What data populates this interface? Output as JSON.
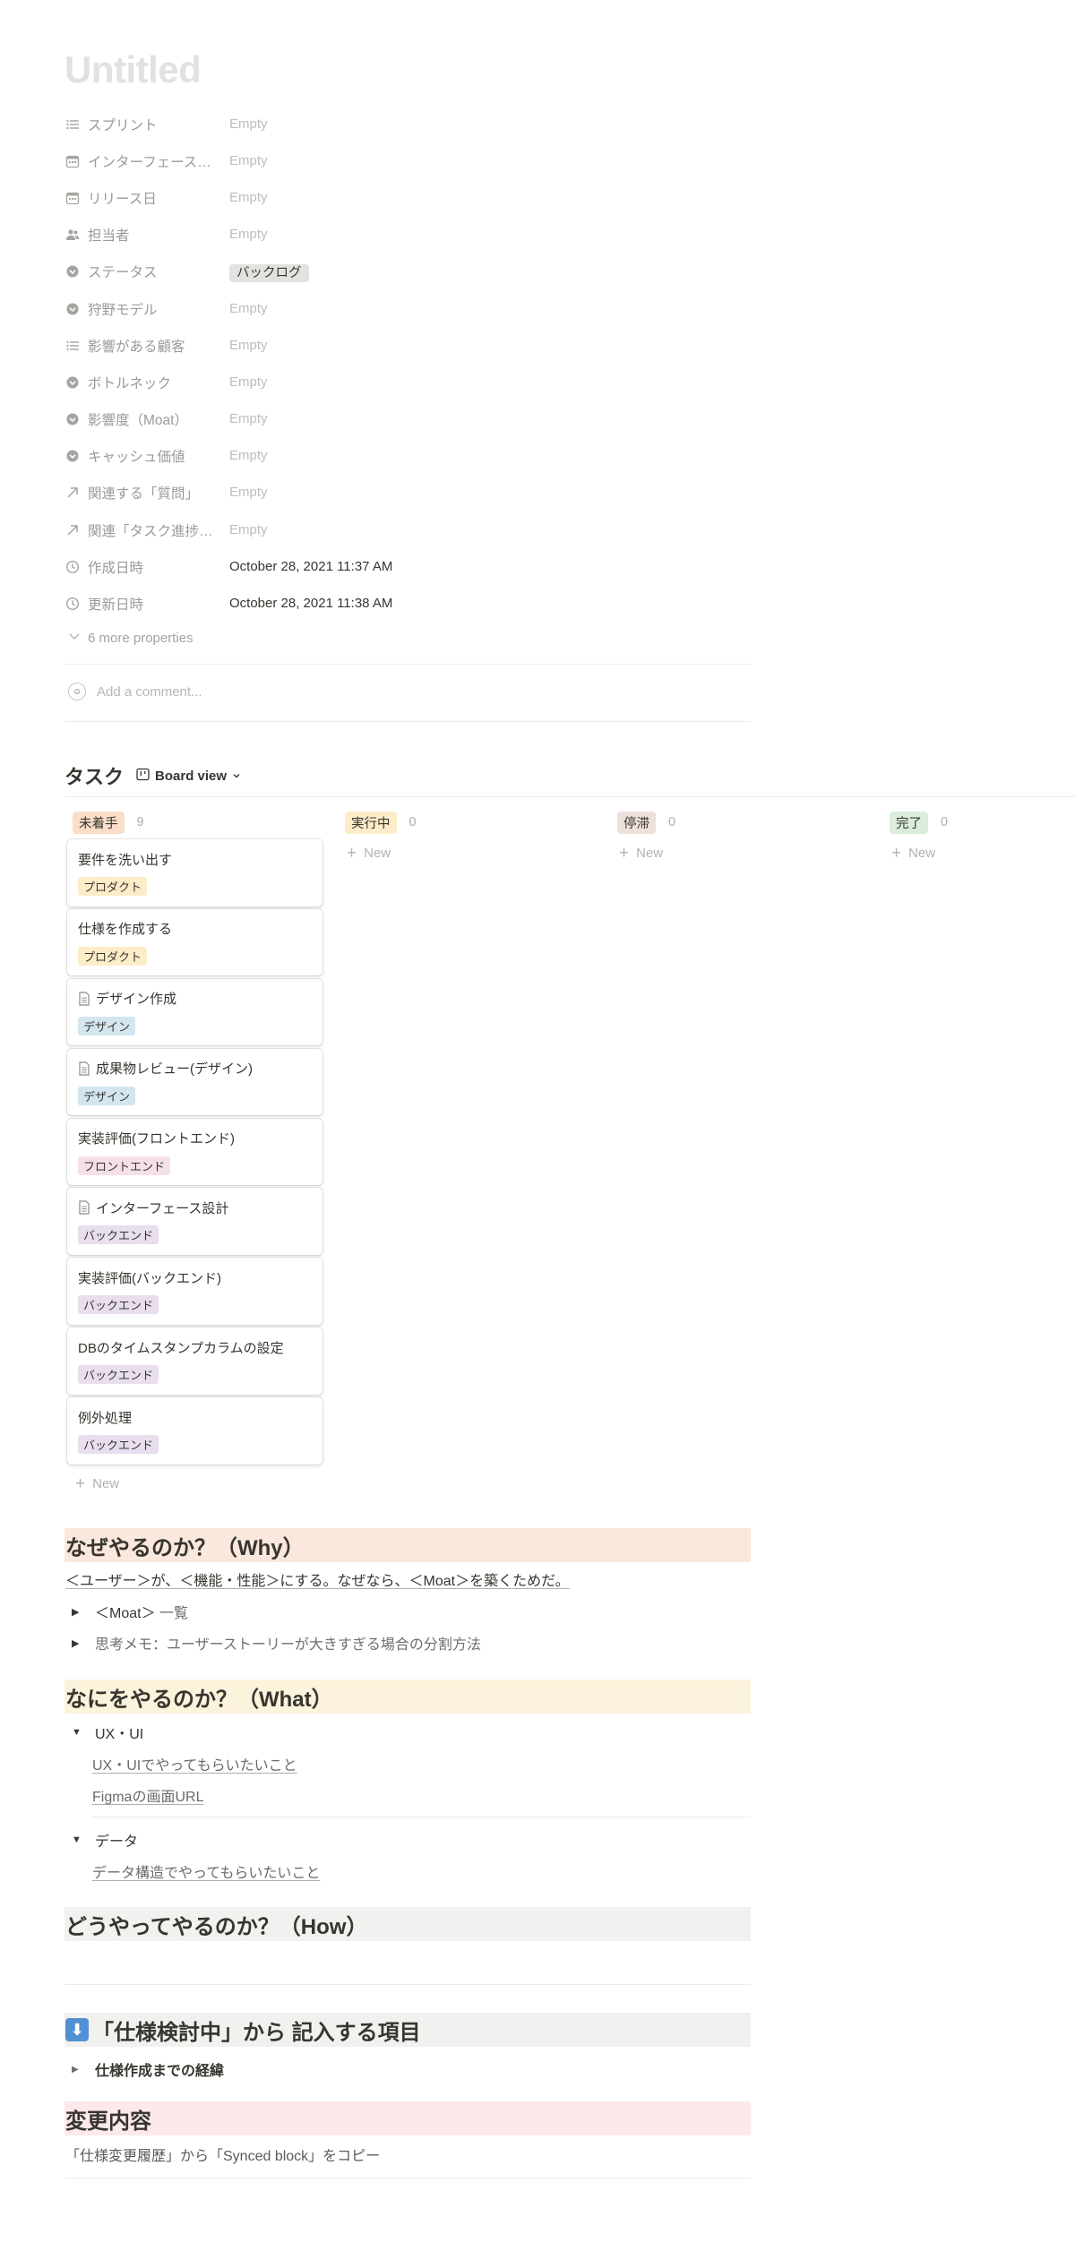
{
  "page": {
    "title": "Untitled"
  },
  "properties": [
    {
      "icon": "list-icon",
      "name": "スプリント",
      "value": "Empty",
      "filled": false
    },
    {
      "icon": "calendar-icon",
      "name": "インターフェース…",
      "value": "Empty",
      "filled": false
    },
    {
      "icon": "calendar-icon",
      "name": "リリース日",
      "value": "Empty",
      "filled": false
    },
    {
      "icon": "people-icon",
      "name": "担当者",
      "value": "Empty",
      "filled": false
    },
    {
      "icon": "select-icon",
      "name": "ステータス",
      "value": "バックログ",
      "chip": true
    },
    {
      "icon": "select-icon",
      "name": "狩野モデル",
      "value": "Empty",
      "filled": false
    },
    {
      "icon": "list-icon",
      "name": "影響がある顧客",
      "value": "Empty",
      "filled": false
    },
    {
      "icon": "select-icon",
      "name": "ボトルネック",
      "value": "Empty",
      "filled": false
    },
    {
      "icon": "select-icon",
      "name": "影響度（Moat）",
      "value": "Empty",
      "filled": false
    },
    {
      "icon": "select-icon",
      "name": "キャッシュ価値",
      "value": "Empty",
      "filled": false
    },
    {
      "icon": "relation-arrow-icon",
      "name": "関連する「質問」",
      "value": "Empty",
      "filled": false
    },
    {
      "icon": "relation-arrow-icon",
      "name": "関連「タスク進捗…",
      "value": "Empty",
      "filled": false
    },
    {
      "icon": "clock-icon",
      "name": "作成日時",
      "value": "October 28, 2021 11:37 AM",
      "filled": true
    },
    {
      "icon": "clock-icon",
      "name": "更新日時",
      "value": "October 28, 2021 11:38 AM",
      "filled": true
    }
  ],
  "more_properties": "6 more properties",
  "comment": {
    "placeholder": "Add a comment..."
  },
  "database": {
    "title": "タスク",
    "view_label": "Board view",
    "new_label": "New",
    "columns": [
      {
        "name": "未着手",
        "count": "9",
        "color": "#fadec9"
      },
      {
        "name": "実行中",
        "count": "0",
        "color": "#fdecc8"
      },
      {
        "name": "停滞",
        "count": "0",
        "color": "#eee0da"
      },
      {
        "name": "完了",
        "count": "0",
        "color": "#dbeddb"
      }
    ],
    "cards": [
      {
        "title": "要件を洗い出す",
        "doc": false,
        "tag": "プロダクト",
        "tag_color": "#fdecc8"
      },
      {
        "title": "仕様を作成する",
        "doc": false,
        "tag": "プロダクト",
        "tag_color": "#fdecc8"
      },
      {
        "title": "デザイン作成",
        "doc": true,
        "tag": "デザイン",
        "tag_color": "#d3e5ef"
      },
      {
        "title": "成果物レビュー(デザイン)",
        "doc": true,
        "tag": "デザイン",
        "tag_color": "#d3e5ef"
      },
      {
        "title": "実装評価(フロントエンド)",
        "doc": false,
        "tag": "フロントエンド",
        "tag_color": "#f5e0e9"
      },
      {
        "title": "インターフェース設計",
        "doc": true,
        "tag": "バックエンド",
        "tag_color": "#e8deee"
      },
      {
        "title": "実装評価(バックエンド)",
        "doc": false,
        "tag": "バックエンド",
        "tag_color": "#e8deee"
      },
      {
        "title": "DBのタイムスタンプカラムの設定",
        "doc": false,
        "tag": "バックエンド",
        "tag_color": "#e8deee"
      },
      {
        "title": "例外処理",
        "doc": false,
        "tag": "バックエンド",
        "tag_color": "#e8deee"
      }
    ]
  },
  "why": {
    "heading": "なぜやるのか？（Why）",
    "statement": "＜ユーザー＞が、＜機能・性能＞にする。なぜなら、＜Moat＞を築くためだ。",
    "toggle1_prefix": "＜Moat＞",
    "toggle1_suffix": " 一覧",
    "toggle2": "思考メモ：ユーザーストーリーが大きすぎる場合の分割方法"
  },
  "what": {
    "heading": "なにをやるのか？（What）",
    "ux_toggle": "UX・UI",
    "ux_link1": "UX・UIでやってもらいたいこと",
    "ux_link2": "Figmaの画面URL",
    "data_toggle": "データ",
    "data_link": "データ構造でやってもらいたいこと"
  },
  "how": {
    "heading": "どうやってやるのか？（How）"
  },
  "spec": {
    "emoji": "⬇",
    "heading": "「仕様検討中」から 記入する項目",
    "toggle": "仕様作成までの経緯"
  },
  "change": {
    "heading": "変更内容",
    "line": "「仕様変更履歴」から「Synced block」をコピー"
  }
}
